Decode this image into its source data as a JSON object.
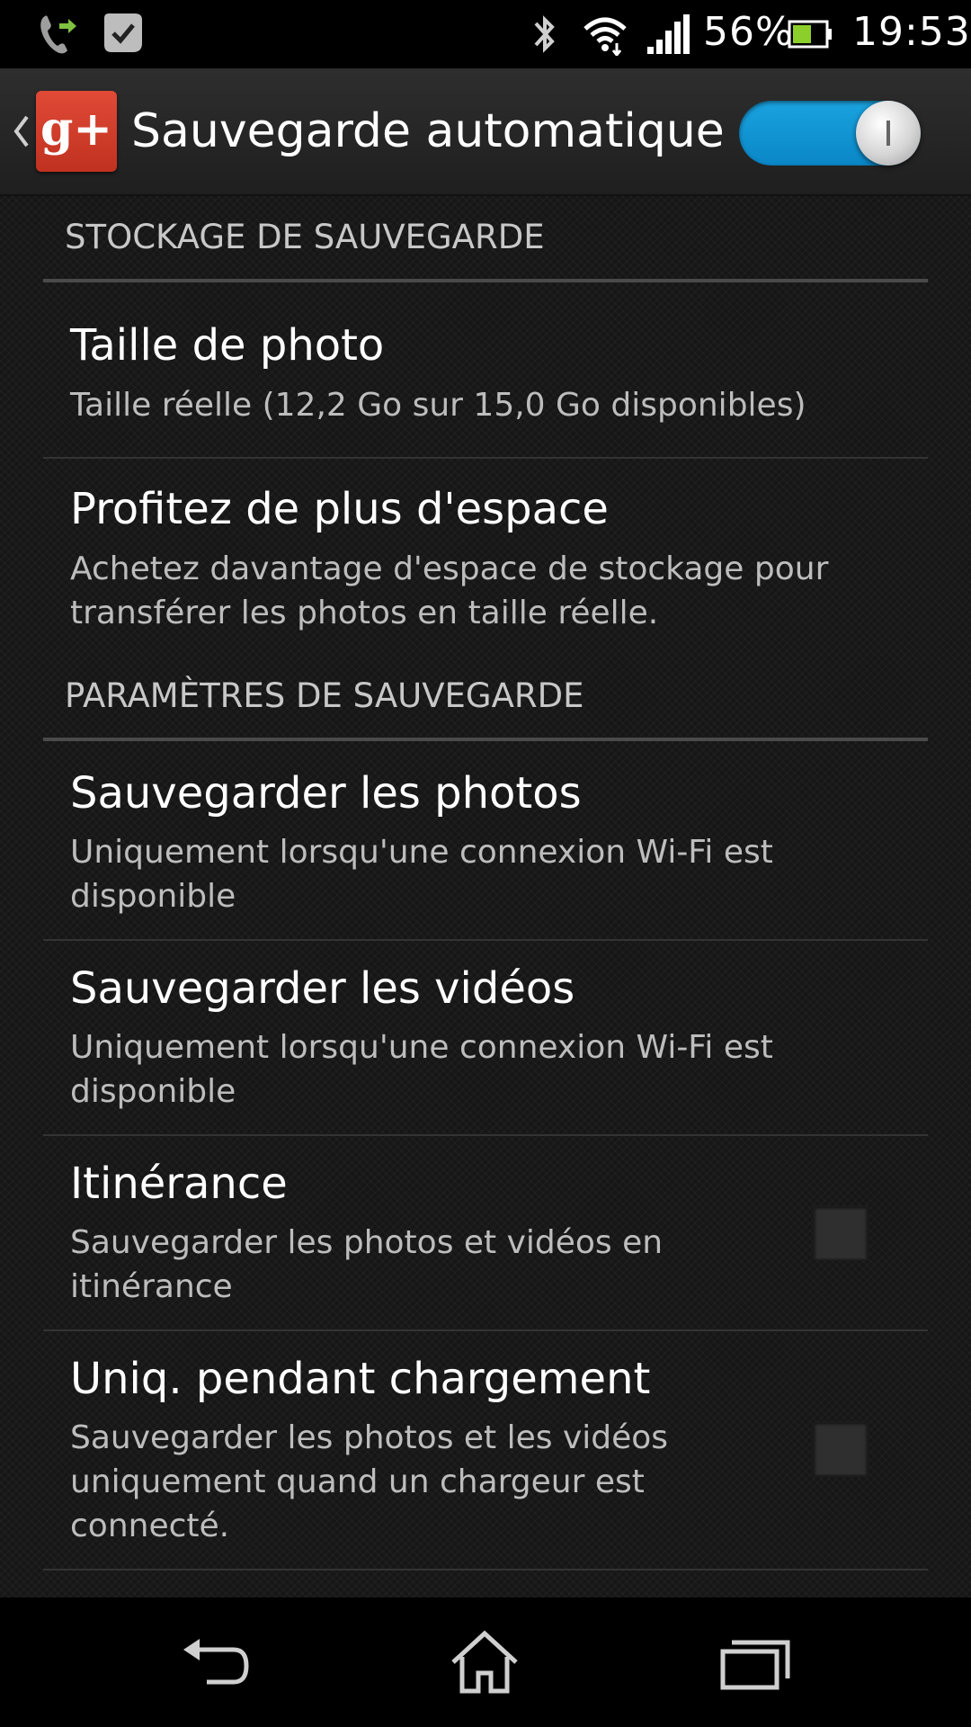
{
  "status_bar": {
    "battery_percent": "56%",
    "time": "19:53",
    "icons": [
      "call-forward-icon",
      "task-check-icon",
      "bluetooth-icon",
      "wifi-icon",
      "signal-icon",
      "battery-icon"
    ]
  },
  "action_bar": {
    "title": "Sauvegarde automatique",
    "logo_text": "g+",
    "toggle_on": true
  },
  "sections": [
    {
      "header": "STOCKAGE DE SAUVEGARDE",
      "items": [
        {
          "title": "Taille de photo",
          "summary": "Taille réelle (12,2 Go sur 15,0 Go disponibles)"
        },
        {
          "title": "Profitez de plus d'espace",
          "summary": "Achetez davantage d'espace de stockage pour transférer les photos en taille réelle."
        }
      ]
    },
    {
      "header": "PARAMÈTRES DE SAUVEGARDE",
      "items": [
        {
          "title": "Sauvegarder les photos",
          "summary": "Uniquement lorsqu'une connexion Wi-Fi est disponible"
        },
        {
          "title": "Sauvegarder les vidéos",
          "summary": "Uniquement lorsqu'une connexion Wi-Fi est disponible"
        },
        {
          "title": "Itinérance",
          "summary": "Sauvegarder les photos et vidéos en itinérance",
          "checked": false
        },
        {
          "title": "Uniq. pendant chargement",
          "summary": "Sauvegarder les photos et les vidéos uniquement quand un chargeur est connecté.",
          "checked": false
        }
      ]
    }
  ],
  "colors": {
    "switch_on": "#1aa3e0",
    "logo_red": "#dd4b39",
    "background": "#161616"
  },
  "nav_bar": {
    "buttons": [
      "back-icon",
      "home-icon",
      "recent-apps-icon"
    ]
  }
}
